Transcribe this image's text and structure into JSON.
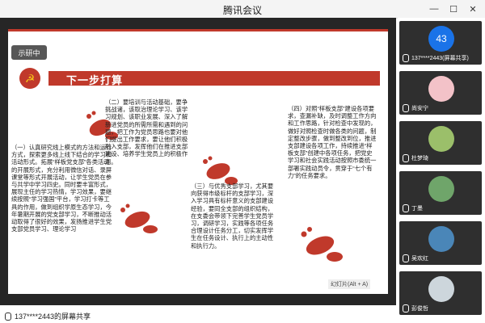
{
  "window": {
    "title": "腾讯会议",
    "controls": [
      "minimize-icon",
      "maximize-icon",
      "close-icon"
    ]
  },
  "slide": {
    "logo_text": "示研中",
    "heading": "下一步打算",
    "section_one": "（一）认真研究线上模式的方法和运行方式，探索更多线上线下结合的学习和活动形式。拓展“样板党支部”各类活动的开展形式，充分利用微信对话、录屏课堂等形式开展活动，让学生党员在参与共学中学习四史。同时要丰富形式，展现主任的学习热情，学习效果，要继续按照“学习强国”平台，学习打卡等工具的作用，做到组织学原生态学习，今年暑期开展的党支部学习，不断推动活动取得了很好的效果，发扬推进学生党支部党员学习、理论学习",
    "section_two": "（二）要培训与活动基础，要争挑战诸，该取治理论学习、该学习规划、该职业发展、深入了解新进党员的所需所需和遇到的问题，把工作为党员思路也要对他们提出工作要求，要让他们积极融入支部，发挥他们在推进支部建设、培养学生党员上的积极作用。",
    "section_three": "（三）与优秀支部学习，尤其要向获得市级标杆的支部学习，深入学习具有标杆意义的支部建设经验，要同全支部的组织结构，在支委会带领下完善学生党员学习，调研学习，实践等各项任务合理设计任务分工，切实发挥学生在任务设计、执行上的主动性和执行力。",
    "section_four": "（四）对照“样板支部”建设各项要求，查漏补缺，及时调整工作方向和工作思路，针对检查中发现的，做好对照检查时做各类的问题，制定整改步骤，做到整改到位，推进支部建设各项工作，持续推进“样板支部”创建中各项任务，把党史学习和社会实践活动按照市委统一部署实践动员令，贯穿于“七个有力”的任务要求。",
    "zoom_label": "幻灯片(Alt + A)"
  },
  "participants": [
    {
      "name": "137****2443(屏幕共享)",
      "type": "initial",
      "initial": "43",
      "avatar_color": "#1a73e8"
    },
    {
      "name": "尚安宁",
      "type": "avatar",
      "avatar_color": "#f3c2c8"
    },
    {
      "name": "杜梦琦",
      "type": "avatar",
      "avatar_color": "#9bbf6a"
    },
    {
      "name": "丁墨",
      "type": "avatar",
      "avatar_color": "#6fa56a"
    },
    {
      "name": "吴欢红",
      "type": "avatar",
      "avatar_color": "#4a86b8"
    },
    {
      "name": "彭俊哲",
      "type": "avatar",
      "avatar_color": "#cdd6dc"
    }
  ],
  "bottom": {
    "share_label": "137****2443的屏幕共享"
  },
  "colors": {
    "accent_red": "#c0392b",
    "dark_red": "#8f1a1a",
    "stage_bg": "#262626"
  }
}
